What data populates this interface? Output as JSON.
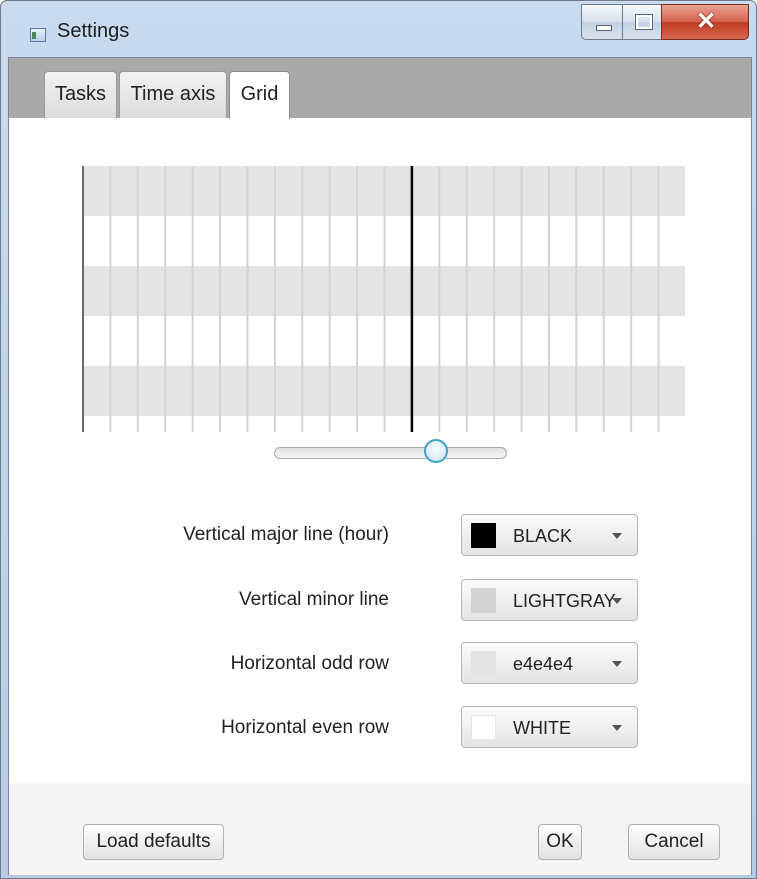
{
  "window": {
    "title": "Settings"
  },
  "tabs": [
    {
      "label": "Tasks",
      "active": false
    },
    {
      "label": "Time axis",
      "active": false
    },
    {
      "label": "Grid",
      "active": true
    }
  ],
  "preview": {
    "odd_row_color": "#e4e4e4",
    "even_row_color": "#ffffff",
    "major_line_color": "#000000",
    "minor_line_color": "#d3d3d3",
    "rows": 5,
    "minor_columns": 22,
    "major_line_index": 12
  },
  "slider": {
    "value_fraction": 0.7
  },
  "settings": [
    {
      "label": "Vertical major line (hour)",
      "value": "BLACK",
      "color": "#000000"
    },
    {
      "label": "Vertical minor line",
      "value": "LIGHTGRAY",
      "color": "#d3d3d3"
    },
    {
      "label": "Horizontal odd row",
      "value": "e4e4e4",
      "color": "#e4e4e4"
    },
    {
      "label": "Horizontal even row",
      "value": "WHITE",
      "color": "#ffffff"
    }
  ],
  "buttons": {
    "load_defaults": "Load defaults",
    "ok": "OK",
    "cancel": "Cancel"
  },
  "icons": {
    "app": "app-window-icon",
    "minimize": "minimize-icon",
    "maximize": "maximize-icon",
    "close": "close-icon"
  }
}
